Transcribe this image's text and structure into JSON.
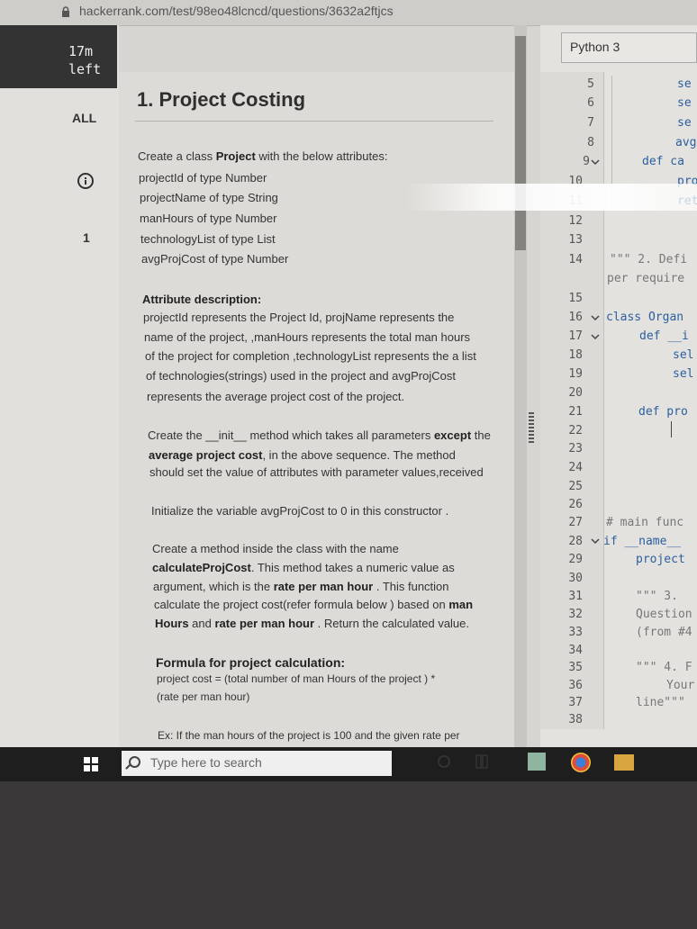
{
  "browser": {
    "url": "hackerrank.com/test/98eo48lcncd/questions/3632a2ftjcs"
  },
  "sidebar": {
    "timer_value": "17m",
    "timer_label": "left",
    "all_label": "ALL",
    "question_number": "1"
  },
  "problem": {
    "title": "1. Project Costing",
    "intro_pre": "Create a class ",
    "intro_bold": "Project",
    "intro_post": " with the below attributes:",
    "attributes": [
      "projectId of type Number",
      "projectName of type String",
      "manHours of type Number",
      "technologyList of type List",
      "avgProjCost of type Number"
    ],
    "attr_desc_heading": "Attribute description:",
    "attr_desc_lines": [
      "projectId represents the Project Id, projName represents the",
      "name of the project, ,manHours represents the total man hours",
      "of the project for completion ,technologyList represents the a list",
      "of technologies(strings) used in the project and avgProjCost",
      "represents the average project cost of the project."
    ],
    "init_line1_pre": "Create the __init__ method which takes all parameters ",
    "init_line1_bold": "except",
    "init_line1_post": " the",
    "init_line2_bold": "average project cost",
    "init_line2_post": ", in the above sequence. The method",
    "init_line3": "should set the value of attributes with parameter values,received",
    "init_avg_line": "Initialize the variable avgProjCost to 0 in this constructor .",
    "method_line1": "Create a method inside the class with the name",
    "method_line2_bold": "calculateProjCost",
    "method_line2_post": ". This method takes a numeric value as",
    "method_line3_pre": "argument, which is the ",
    "method_line3_bold": "rate per man hour",
    "method_line3_post": " . This function",
    "method_line4_pre": "calculate the project cost(refer formula below )  based on  ",
    "method_line4_bold": "man",
    "method_line5_bold1": "Hours",
    "method_line5_mid": " and ",
    "method_line5_bold2": "rate per man hour",
    "method_line5_post": " . Return the calculated value.",
    "formula_heading": "Formula for project calculation:",
    "formula_line1": "project cost = (total number of man Hours of the project ) *",
    "formula_line2": "(rate per  man hour)",
    "example_line": "Ex: If the man hours of the project is 100 and the given rate per"
  },
  "editor": {
    "language": "Python 3",
    "line_numbers": [
      "5",
      "6",
      "7",
      "8",
      "9",
      "10",
      "11",
      "12",
      "13",
      "14",
      "15",
      "16",
      "17",
      "18",
      "19",
      "20",
      "21",
      "22",
      "23",
      "24",
      "25",
      "26",
      "27",
      "28",
      "29",
      "30",
      "31",
      "32",
      "33",
      "34",
      "35",
      "36",
      "37",
      "38"
    ],
    "code_fragments": [
      "se",
      "se",
      "se",
      "avg",
      "def ca",
      "pro",
      "ret",
      "\"\"\" 2. Defi",
      "per require",
      "class Organ",
      "def __i",
      "sel",
      "sel",
      "def pro",
      "# main func",
      "if __name__",
      "project",
      "\"\"\" 3. ",
      "Question",
      "(from #4",
      "\"\"\" 4. F",
      "Your",
      "line\"\"\""
    ]
  },
  "taskbar": {
    "search_placeholder": "Type here to search"
  }
}
